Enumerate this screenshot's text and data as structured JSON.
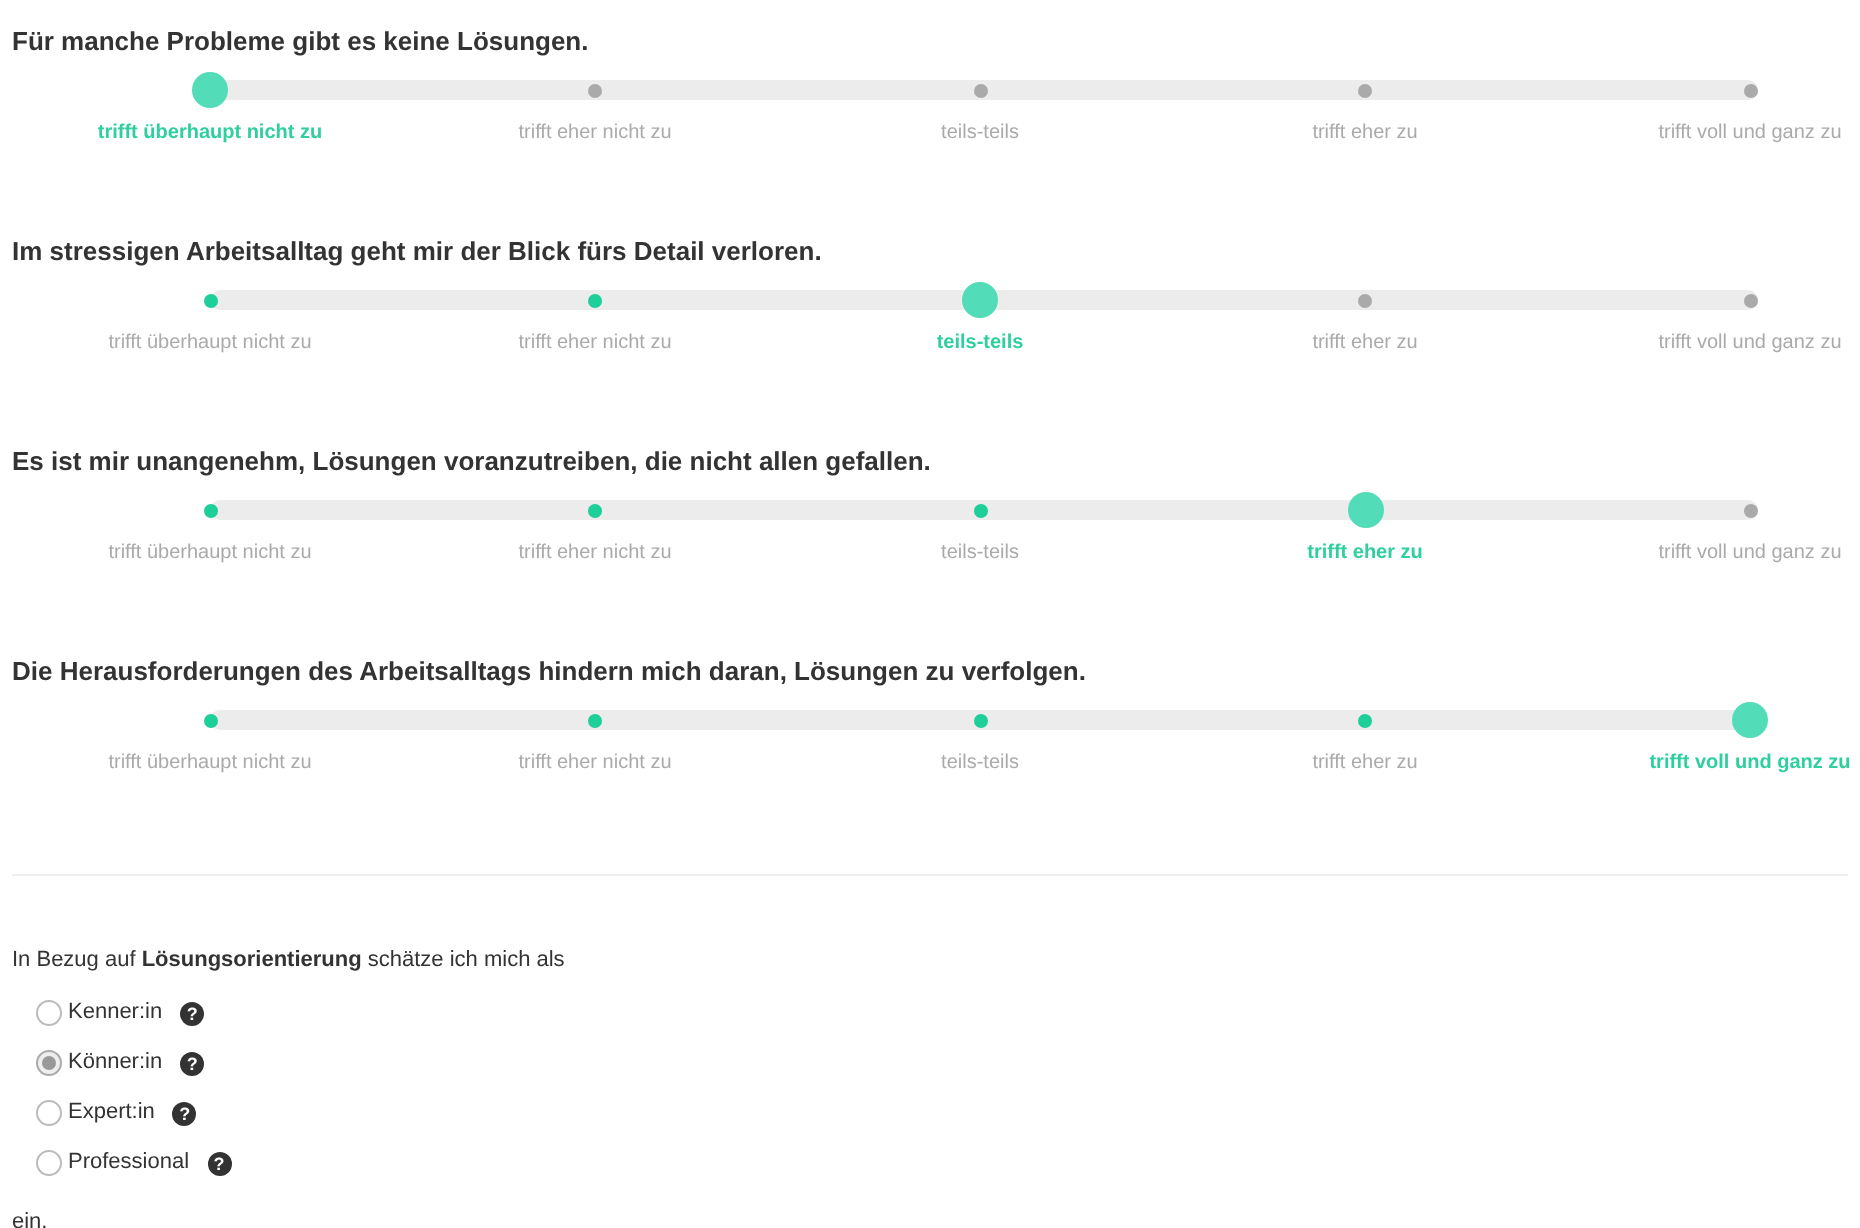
{
  "questions": [
    {
      "title": "Für manche Probleme gibt es keine Lösungen.",
      "options": [
        {
          "label": "trifft überhaupt nicht zu",
          "selected": true
        },
        {
          "label": "trifft eher nicht zu",
          "selected": false
        },
        {
          "label": "teils-teils",
          "selected": false
        },
        {
          "label": "trifft eher zu",
          "selected": false
        },
        {
          "label": "trifft voll und ganz zu",
          "selected": false
        }
      ]
    },
    {
      "title": "Im stressigen Arbeitsalltag geht mir der Blick fürs Detail verloren.",
      "options": [
        {
          "label": "trifft überhaupt nicht zu",
          "selected": false
        },
        {
          "label": "trifft eher nicht zu",
          "selected": false
        },
        {
          "label": "teils-teils",
          "selected": true
        },
        {
          "label": "trifft eher zu",
          "selected": false
        },
        {
          "label": "trifft voll und ganz zu",
          "selected": false
        }
      ]
    },
    {
      "title": "Es ist mir unangenehm, Lösungen voranzutreiben, die nicht allen gefallen.",
      "options": [
        {
          "label": "trifft überhaupt nicht zu",
          "selected": false
        },
        {
          "label": "trifft eher nicht zu",
          "selected": false
        },
        {
          "label": "teils-teils",
          "selected": false
        },
        {
          "label": "trifft eher zu",
          "selected": true
        },
        {
          "label": "trifft voll und ganz zu",
          "selected": false
        }
      ]
    },
    {
      "title": "Die Herausforderungen des Arbeitsalltags hindern mich daran, Lösungen zu verfolgen.",
      "options": [
        {
          "label": "trifft überhaupt nicht zu",
          "selected": false
        },
        {
          "label": "trifft eher nicht zu",
          "selected": false
        },
        {
          "label": "teils-teils",
          "selected": false
        },
        {
          "label": "trifft eher zu",
          "selected": false
        },
        {
          "label": "trifft voll und ganz zu",
          "selected": true
        }
      ]
    }
  ],
  "self_assessment": {
    "intro": "In Bezug auf **Lösungsorientierung** schätze ich mich als",
    "options": [
      {
        "label": "Kenner:in",
        "selected": false,
        "help": "?"
      },
      {
        "label": "Könner:in",
        "selected": true,
        "help": "?"
      },
      {
        "label": "Expert:in",
        "selected": false,
        "help": "?"
      },
      {
        "label": "Professional",
        "selected": false,
        "help": "?"
      }
    ],
    "outro": "ein."
  }
}
